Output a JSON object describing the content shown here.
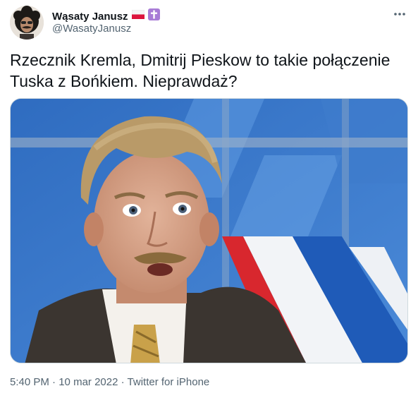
{
  "tweet": {
    "author": {
      "display_name": "Wąsaty Janusz",
      "handle": "@WasatyJanusz",
      "badges": [
        "poland-flag-icon",
        "purple-cross-icon"
      ]
    },
    "text_lines": [
      "Rzecznik Kremla, Dmitrij Pieskow to takie połączenie",
      "Tuska z Bońkiem. Nieprawdaż?"
    ],
    "media": {
      "type": "photo"
    },
    "time": "5:40 PM",
    "separator": "·",
    "date": "10 mar 2022",
    "source": "Twitter for iPhone"
  },
  "colors": {
    "text_primary": "#0f1419",
    "text_secondary": "#536471",
    "badge_purple": "#a87cd6",
    "flag_red": "#dc143c"
  }
}
